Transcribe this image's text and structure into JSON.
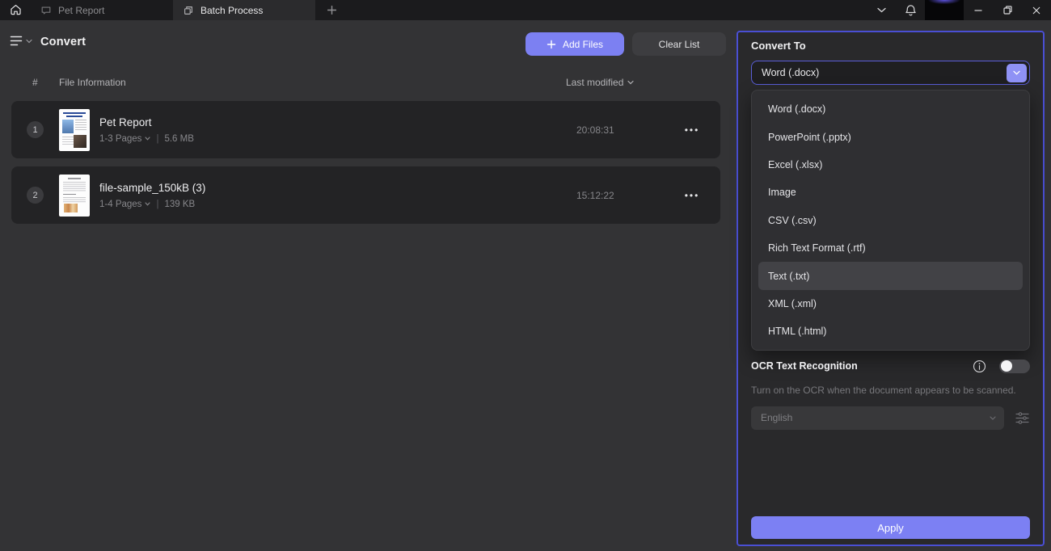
{
  "titlebar": {
    "tabs": [
      {
        "label": "Pet Report"
      },
      {
        "label": "Batch Process"
      }
    ]
  },
  "toolbar": {
    "title": "Convert",
    "add_files_label": "Add Files",
    "clear_list_label": "Clear List"
  },
  "file_table": {
    "columns": {
      "index": "#",
      "info": "File Information",
      "modified": "Last modified"
    },
    "rows": [
      {
        "index": "1",
        "name": "Pet Report",
        "pages": "1-3 Pages",
        "size": "5.6 MB",
        "modified": "20:08:31"
      },
      {
        "index": "2",
        "name": "file-sample_150kB (3)",
        "pages": "1-4 Pages",
        "size": "139 KB",
        "modified": "15:12:22"
      }
    ],
    "meta_separator": "|"
  },
  "convert_panel": {
    "title": "Convert To",
    "selected_format": "Word (.docx)",
    "format_options": [
      "Word (.docx)",
      "PowerPoint (.pptx)",
      "Excel (.xlsx)",
      "Image",
      "CSV (.csv)",
      "Rich Text Format (.rtf)",
      "Text (.txt)",
      "XML (.xml)",
      "HTML (.html)"
    ],
    "highlighted_option": "Text (.txt)",
    "ocr": {
      "title": "OCR Text Recognition",
      "description": "Turn on the OCR when the document appears to be scanned.",
      "language": "English",
      "enabled": false
    },
    "apply_label": "Apply"
  },
  "colors": {
    "accent": "#7c80f2",
    "panel_border": "#4a4fd4",
    "row_background": "#232325"
  }
}
